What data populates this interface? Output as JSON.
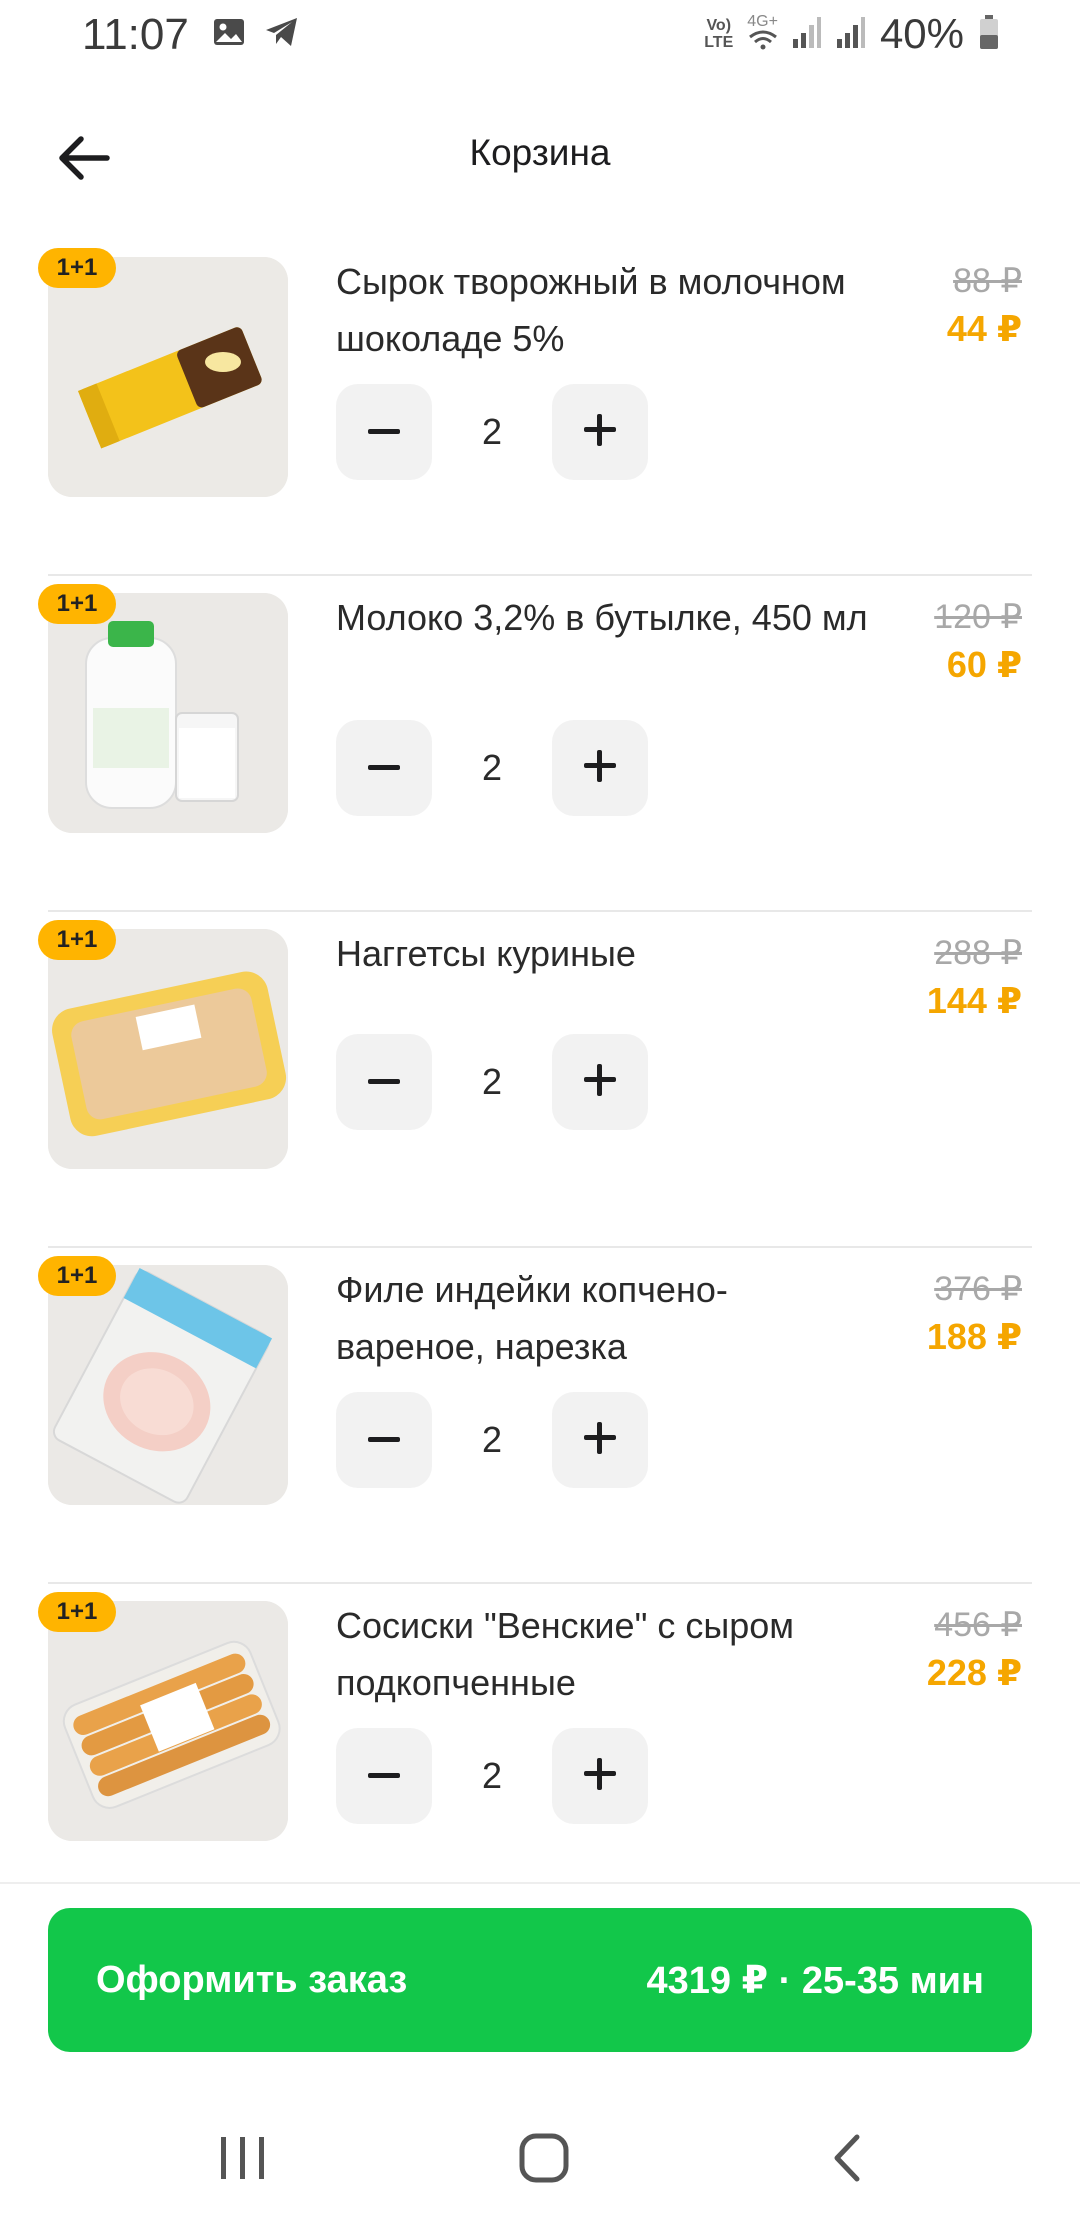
{
  "status_bar": {
    "time": "11:07",
    "battery": "40%",
    "net_top": "Vo)",
    "net_bottom": "LTE",
    "net_4g": "4G+",
    "icons": [
      "image-icon",
      "telegram-icon",
      "wifi-icon",
      "signal-icon",
      "signal-icon",
      "battery-icon"
    ]
  },
  "header": {
    "title": "Корзина",
    "back_icon": "arrow-left-icon"
  },
  "colors": {
    "accent_green": "#12c74a",
    "price_orange": "#f5a600",
    "badge_yellow": "#ffb400",
    "old_price_gray": "#a8a8a8"
  },
  "items": [
    {
      "name": "Сырок творожный в молочном шоколаде 5%",
      "badge": "1+1",
      "old_price": "88 ₽",
      "price": "44 ₽",
      "qty": "2",
      "image": "curd-snack-image"
    },
    {
      "name": "Молоко 3,2% в бутылке, 450 мл",
      "badge": "1+1",
      "old_price": "120 ₽",
      "price": "60 ₽",
      "qty": "2",
      "image": "milk-bottle-image"
    },
    {
      "name": "Наггетсы куриные",
      "badge": "1+1",
      "old_price": "288 ₽",
      "price": "144 ₽",
      "qty": "2",
      "image": "nuggets-tray-image"
    },
    {
      "name": "Филе индейки копчено-вареное, нарезка",
      "badge": "1+1",
      "old_price": "376 ₽",
      "price": "188 ₽",
      "qty": "2",
      "image": "turkey-slices-image"
    },
    {
      "name": "Сосиски \"Венские\" с сыром подкопченные",
      "badge": "1+1",
      "old_price": "456 ₽",
      "price": "228 ₽",
      "qty": "2",
      "image": "sausages-pack-image"
    }
  ],
  "checkout": {
    "label": "Оформить заказ",
    "summary": "4319 ₽ · 25-35 мин"
  },
  "nav": {
    "recents_icon": "recent-apps-icon",
    "home_icon": "home-icon",
    "back_icon": "back-chevron-icon"
  }
}
